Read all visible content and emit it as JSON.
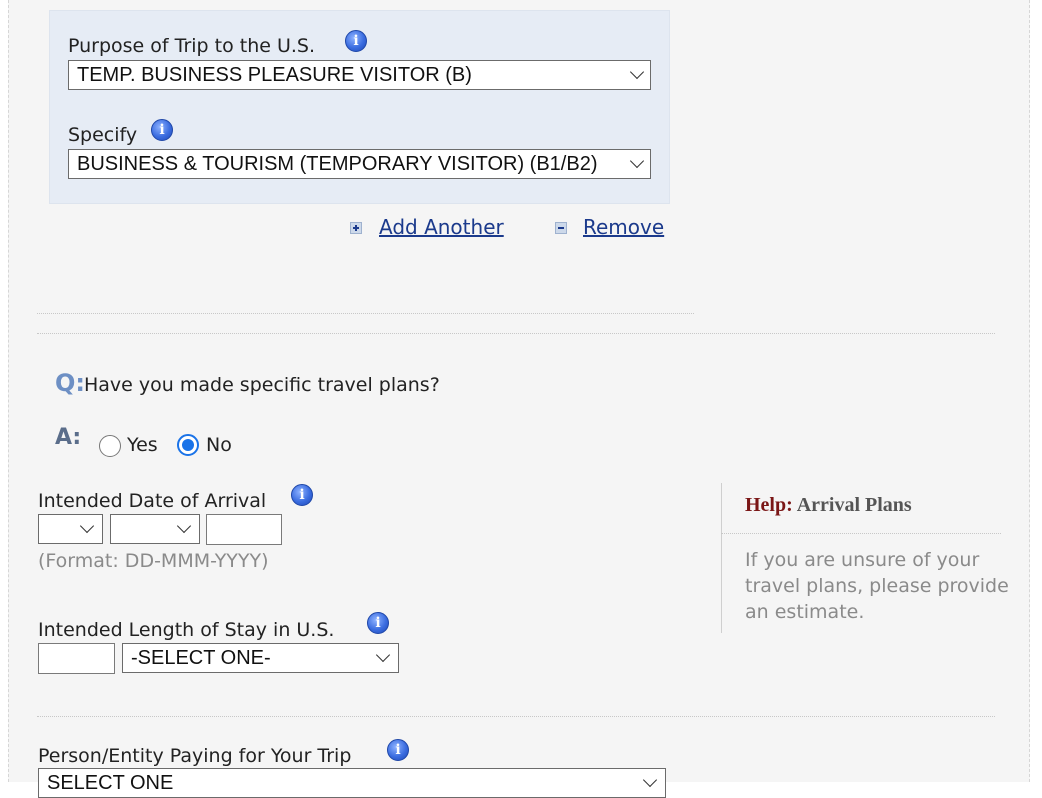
{
  "purpose": {
    "purpose_label": "Purpose of Trip to the U.S.",
    "purpose_value": "TEMP. BUSINESS PLEASURE VISITOR (B)",
    "specify_label": "Specify",
    "specify_value": "BUSINESS & TOURISM (TEMPORARY VISITOR) (B1/B2)"
  },
  "actions": {
    "add_another": "Add Another",
    "remove": "Remove"
  },
  "travel_plans": {
    "q_marker": "Q:",
    "question": "Have you made specific travel plans?",
    "a_marker": "A:",
    "yes_label": "Yes",
    "no_label": "No",
    "selected": "No"
  },
  "arrival": {
    "label": "Intended Date of Arrival",
    "day_value": "",
    "month_value": "",
    "year_value": "",
    "format_hint": "(Format: DD-MMM-YYYY)"
  },
  "stay": {
    "label": "Intended Length of Stay in U.S.",
    "number_value": "",
    "unit_value": "-SELECT ONE-"
  },
  "payer": {
    "label": "Person/Entity Paying for Your Trip",
    "value": "SELECT ONE"
  },
  "help": {
    "title_prefix": "Help:",
    "title": "Arrival Plans",
    "text": "If you are unsure of your travel plans, please provide an estimate."
  },
  "icons": {
    "info": "info-icon",
    "add": "plus-icon",
    "remove": "minus-icon",
    "dropdown": "chevron-down-icon"
  },
  "colors": {
    "link": "#1b3a8c",
    "help_title": "#7a1616",
    "radio_accent": "#1a73e8",
    "purpose_box": "#e6ecf5"
  }
}
